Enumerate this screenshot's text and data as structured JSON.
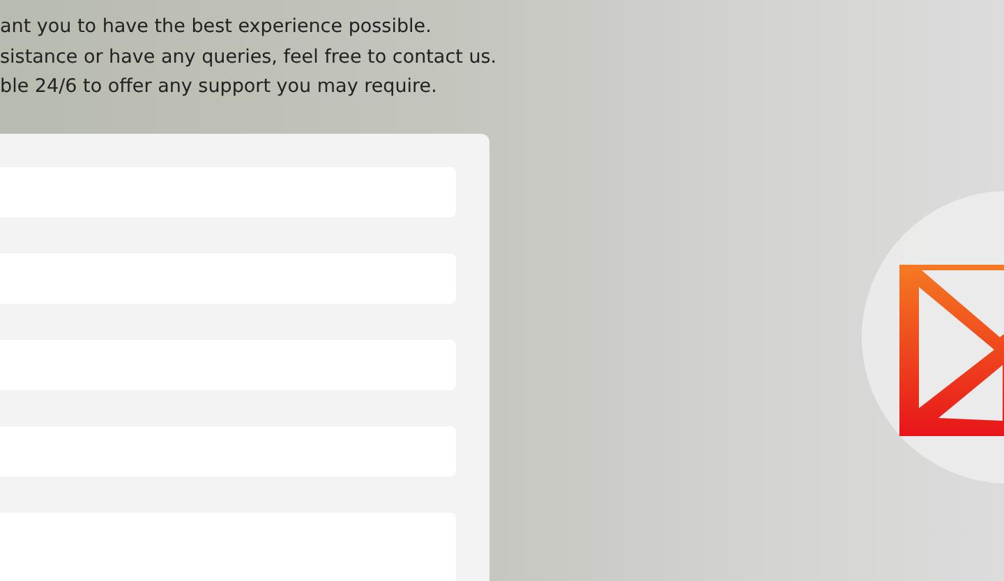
{
  "intro_lines": [
    "ant you to have the best experience possible.",
    "sistance or have any queries, feel free to contact us.",
    "ble 24/6 to offer any support you may require."
  ],
  "form": {
    "fields": [
      {
        "kind": "input"
      },
      {
        "kind": "input"
      },
      {
        "kind": "input"
      },
      {
        "kind": "input"
      },
      {
        "kind": "textarea"
      }
    ]
  }
}
